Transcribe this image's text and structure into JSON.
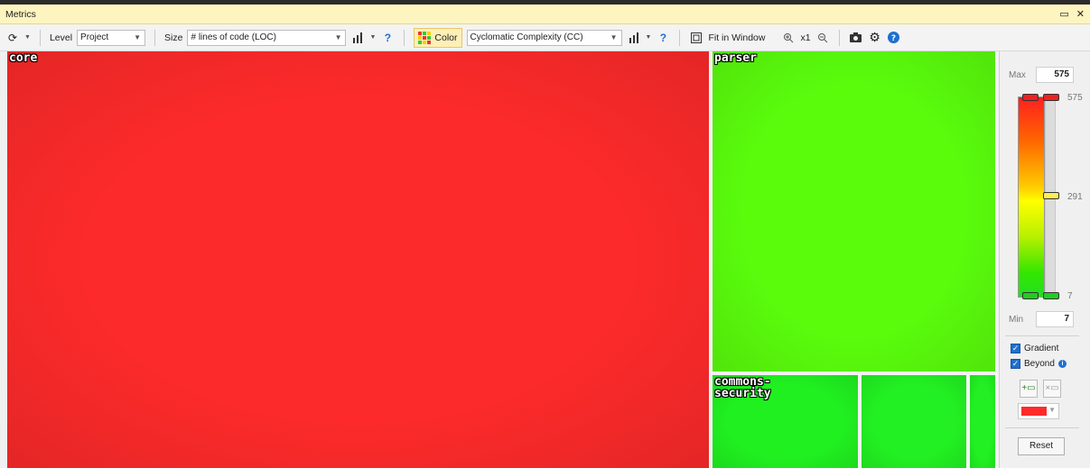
{
  "window": {
    "title": "Metrics",
    "controls": [
      "▭",
      "✕"
    ]
  },
  "toolbar": {
    "refresh_icon": "refresh-icon",
    "level_label": "Level",
    "level_value": "Project",
    "size_label": "Size",
    "size_value": "# lines of code (LOC)",
    "color_label": "Color",
    "color_value": "Cyclomatic Complexity (CC)",
    "fit_label": "Fit in Window",
    "zoom_label": "x1"
  },
  "treemap": {
    "cells": [
      {
        "name": "core",
        "color": "#fc2a2a"
      },
      {
        "name": "parser",
        "color": "#5afc0c"
      },
      {
        "name": "commons-\nsecurity",
        "color": "#20f020"
      },
      {
        "name": "",
        "color": "#22f022"
      },
      {
        "name": "",
        "color": "#22f022"
      }
    ]
  },
  "legend": {
    "max_label": "Max",
    "max_value": "575",
    "min_label": "Min",
    "min_value": "7",
    "scale_top": "575",
    "scale_mid": "291",
    "scale_bottom": "7",
    "gradient_label": "Gradient",
    "beyond_label": "Beyond",
    "selected_color": "#ff2a2a",
    "reset_label": "Reset"
  }
}
